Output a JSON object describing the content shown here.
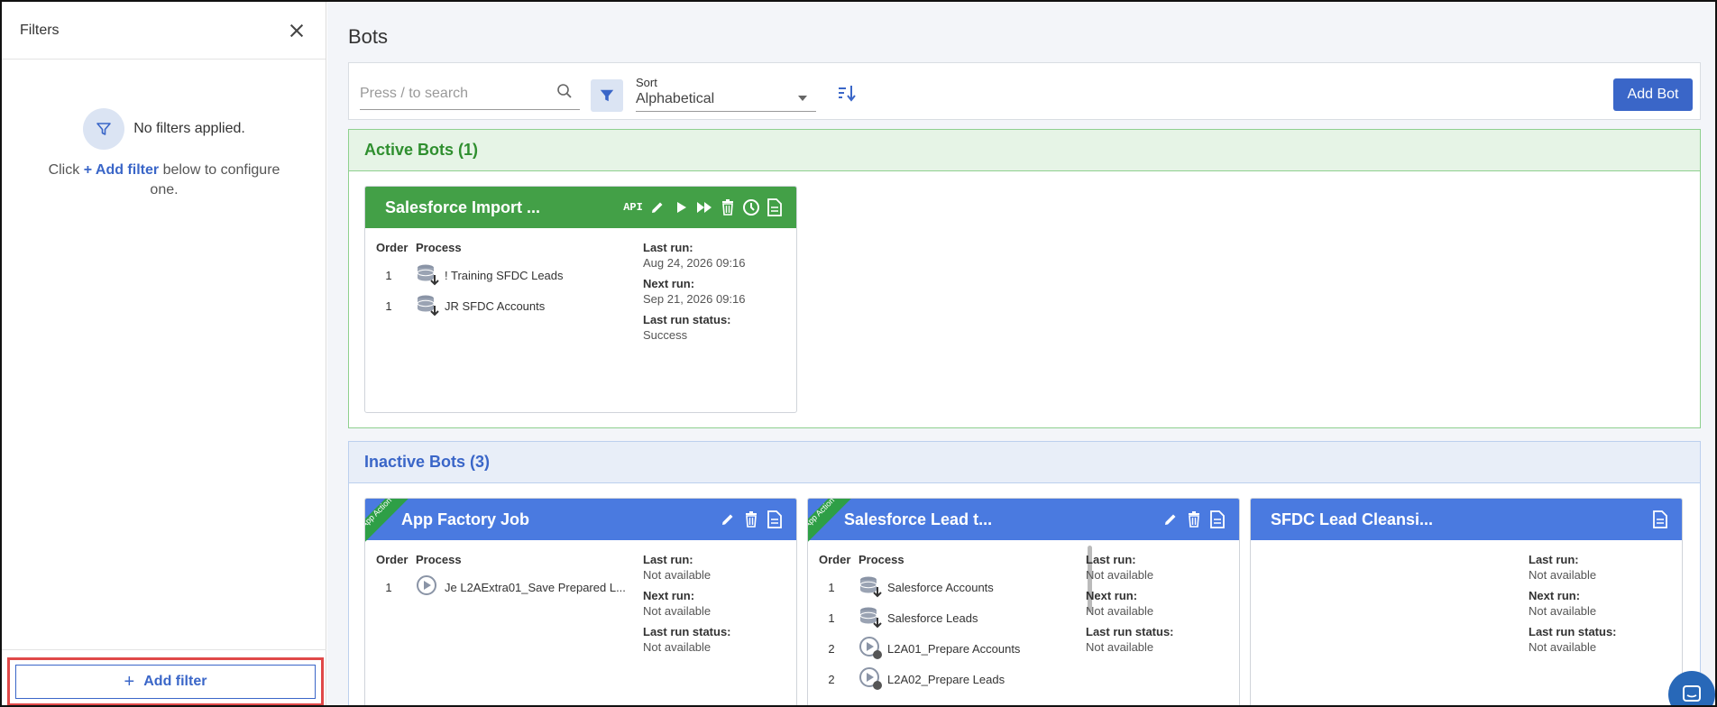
{
  "sidebar": {
    "title": "Filters",
    "empty_text": "No filters applied.",
    "help_prefix": "Click",
    "help_link": "+ Add filter",
    "help_suffix": "below to configure one.",
    "add_filter_label": "Add filter"
  },
  "main": {
    "title": "Bots",
    "search": {
      "placeholder": "Press / to search"
    },
    "sort": {
      "label": "Sort",
      "value": "Alphabetical"
    },
    "add_bot_label": "Add Bot"
  },
  "labels": {
    "order": "Order",
    "process": "Process",
    "last_run": "Last run:",
    "next_run": "Next run:",
    "last_run_status": "Last run status:"
  },
  "active": {
    "heading": "Active Bots (1)",
    "bots": [
      {
        "name": "Salesforce Import ...",
        "api_label": "API",
        "processes": [
          {
            "order": "1",
            "name": "! Training SFDC Leads"
          },
          {
            "order": "1",
            "name": "JR SFDC Accounts"
          }
        ],
        "last_run": "Aug 24, 2026 09:16",
        "next_run": "Sep 21, 2026 09:16",
        "last_run_status": "Success"
      }
    ]
  },
  "inactive": {
    "heading": "Inactive Bots (3)",
    "ribbon_text": "App Action",
    "bots": [
      {
        "name": "App Factory Job",
        "processes": [
          {
            "order": "1",
            "name": "Je   L2AExtra01_Save Prepared L..."
          }
        ],
        "last_run": "Not available",
        "next_run": "Not available",
        "last_run_status": "Not available"
      },
      {
        "name": "Salesforce Lead t...",
        "processes": [
          {
            "order": "1",
            "name": "Salesforce Accounts"
          },
          {
            "order": "1",
            "name": "Salesforce Leads"
          },
          {
            "order": "2",
            "name": "L2A01_Prepare Accounts"
          },
          {
            "order": "2",
            "name": "L2A02_Prepare Leads"
          }
        ],
        "last_run": "Not available",
        "next_run": "Not available",
        "last_run_status": "Not available"
      },
      {
        "name": "SFDC Lead Cleansi...",
        "last_run": "Not available",
        "next_run": "Not available",
        "last_run_status": "Not available"
      }
    ]
  },
  "icons": {
    "close": "close-icon",
    "funnel": "funnel-icon",
    "search": "search-icon",
    "sort_direction": "sort-descending-icon",
    "edit": "pencil-icon",
    "run": "play-icon",
    "run_all": "fast-forward-icon",
    "delete": "trash-icon",
    "schedule": "clock-icon",
    "log": "document-icon",
    "db_download": "database-download-icon",
    "process_run": "play-circle-icon",
    "chat": "chat-icon"
  },
  "colors": {
    "accent": "#3a66c8",
    "active_green": "#43a047",
    "inactive_blue": "#4a7ae0",
    "highlight_red": "#e04848"
  }
}
